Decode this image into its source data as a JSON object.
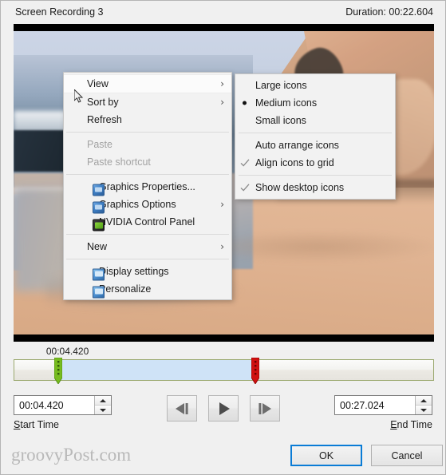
{
  "window": {
    "title": "Screen Recording 3",
    "duration_label": "Duration: 00:22.604"
  },
  "video": {
    "scene_description": "Beach shoreline with ocean waves on the left, sand in the foreground and a rocky cliff on the upper right"
  },
  "context_menu": {
    "items": [
      {
        "label": "View",
        "submenu": true,
        "highlighted": true,
        "icon": null,
        "disabled": false
      },
      {
        "label": "Sort by",
        "submenu": true,
        "highlighted": false,
        "icon": null,
        "disabled": false
      },
      {
        "label": "Refresh",
        "submenu": false,
        "highlighted": false,
        "icon": null,
        "disabled": false
      },
      {
        "separator": true
      },
      {
        "label": "Paste",
        "submenu": false,
        "highlighted": false,
        "icon": null,
        "disabled": true
      },
      {
        "label": "Paste shortcut",
        "submenu": false,
        "highlighted": false,
        "icon": null,
        "disabled": true
      },
      {
        "separator": true
      },
      {
        "label": "Graphics Properties...",
        "submenu": false,
        "highlighted": false,
        "icon": "graphics-properties-icon",
        "disabled": false
      },
      {
        "label": "Graphics Options",
        "submenu": true,
        "highlighted": false,
        "icon": "graphics-options-icon",
        "disabled": false
      },
      {
        "label": "NVIDIA Control Panel",
        "submenu": false,
        "highlighted": false,
        "icon": "nvidia-control-panel-icon",
        "disabled": false
      },
      {
        "separator": true
      },
      {
        "label": "New",
        "submenu": true,
        "highlighted": false,
        "icon": null,
        "disabled": false
      },
      {
        "separator": true
      },
      {
        "label": "Display settings",
        "submenu": false,
        "highlighted": false,
        "icon": "display-settings-icon",
        "disabled": false
      },
      {
        "label": "Personalize",
        "submenu": false,
        "highlighted": false,
        "icon": "personalize-icon",
        "disabled": false
      }
    ]
  },
  "view_submenu": {
    "items": [
      {
        "label": "Large icons",
        "marker": "none"
      },
      {
        "label": "Medium icons",
        "marker": "radio"
      },
      {
        "label": "Small icons",
        "marker": "none"
      },
      {
        "separator": true
      },
      {
        "label": "Auto arrange icons",
        "marker": "none"
      },
      {
        "label": "Align icons to grid",
        "marker": "check"
      },
      {
        "separator": true
      },
      {
        "label": "Show desktop icons",
        "marker": "check"
      }
    ]
  },
  "timeline": {
    "playhead_label": "00:04.420",
    "selection_start_pct": 10.6,
    "selection_end_pct": 57.5,
    "start_handle_color": "#77bc1f",
    "end_handle_color": "#d01010",
    "selection_fill_color": "#cfe3f7"
  },
  "controls": {
    "start_time_value": "00:04.420",
    "start_time_label_prefix": "S",
    "start_time_label_rest": "tart Time",
    "end_time_value": "00:27.024",
    "end_time_label_prefix": "E",
    "end_time_label_rest": "nd Time",
    "previous_frame_icon": "previous-frame-icon",
    "play_icon": "play-icon",
    "next_frame_icon": "next-frame-icon",
    "spinner_up_icon": "caret-up-icon",
    "spinner_down_icon": "caret-down-icon"
  },
  "footer": {
    "watermark": "groovyPost.com",
    "ok_label": "OK",
    "cancel_label": "Cancel",
    "ok_focus_color": "#0a7cd6"
  }
}
